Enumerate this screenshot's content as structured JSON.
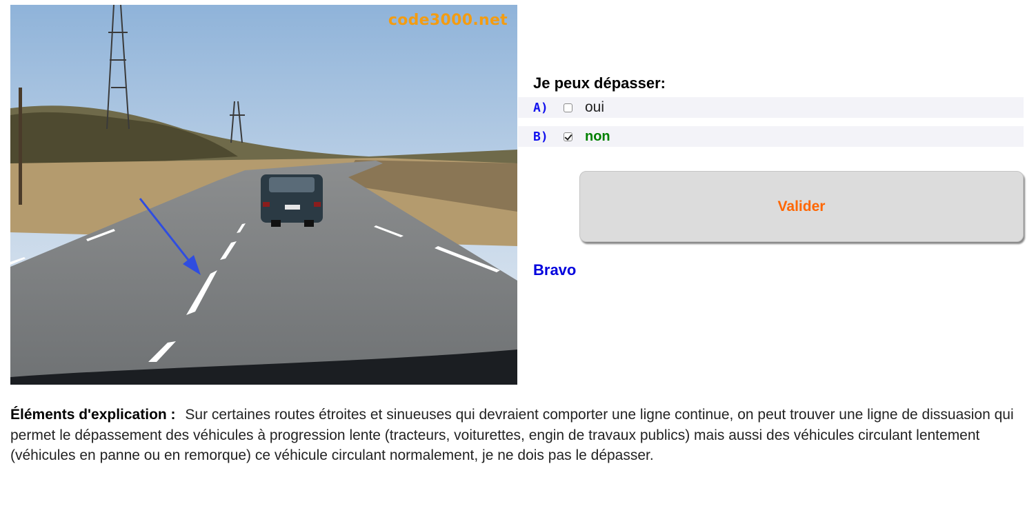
{
  "image": {
    "watermark": "code3000.net",
    "description_icon": "road-photo"
  },
  "question": {
    "title": "Je peux dépasser:",
    "options": [
      {
        "letter": "A)",
        "text": "oui",
        "checked": false
      },
      {
        "letter": "B)",
        "text": "non",
        "checked": true
      }
    ]
  },
  "actions": {
    "validate_label": "Valider"
  },
  "feedback": {
    "text": "Bravo"
  },
  "explanation": {
    "label": "Éléments d'explication :",
    "text": "Sur certaines routes étroites et sinueuses qui devraient comporter une ligne continue, on peut trouver une ligne de dissuasion qui permet le dépassement des véhicules à progression lente (tracteurs, voiturettes, engin de travaux publics) mais aussi des véhicules circulant lentement (véhicules en panne ou en remorque) ce véhicule circulant normalement, je ne dois pas le dépasser."
  },
  "colors": {
    "accent_button_text": "#ff6600",
    "feedback": "#0000dd",
    "correct": "#008000",
    "option_letter": "#1010ee",
    "watermark": "#f39c12"
  }
}
